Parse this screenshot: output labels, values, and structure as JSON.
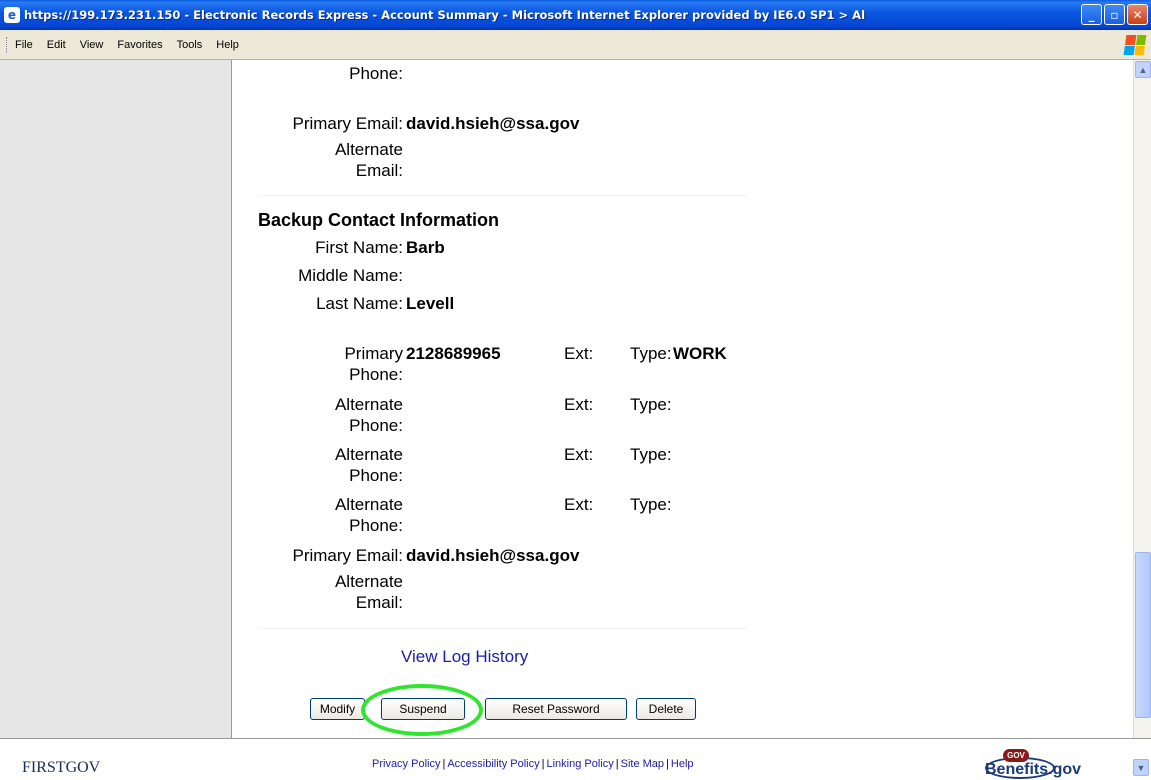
{
  "window": {
    "title": "https://199.173.231.150 - Electronic Records Express - Account Summary - Microsoft Internet Explorer provided by IE6.0 SP1 > Al",
    "ie_icon": "ie-icon",
    "min_glyph": "_",
    "max_glyph": "▫",
    "close_glyph": "✕"
  },
  "menu": {
    "items": [
      "File",
      "Edit",
      "View",
      "Favorites",
      "Tools",
      "Help"
    ]
  },
  "primary_contact": {
    "phone_label_tail": "Phone:",
    "primary_email_label": "Primary Email:",
    "primary_email": "david.hsieh@ssa.gov",
    "alternate_label": "Alternate",
    "email_label": "Email:"
  },
  "backup": {
    "heading": "Backup Contact Information",
    "first_name_label": "First Name:",
    "first_name": "Barb",
    "middle_name_label": "Middle Name:",
    "last_name_label": "Last Name:",
    "last_name": "Levell",
    "phones": [
      {
        "label_top": "Primary",
        "label_bottom": "Phone:",
        "number": "2128689965",
        "ext_label": "Ext:",
        "type_label": "Type:",
        "type": "WORK"
      },
      {
        "label_top": "Alternate",
        "label_bottom": "Phone:",
        "number": "",
        "ext_label": "Ext:",
        "type_label": "Type:",
        "type": ""
      },
      {
        "label_top": "Alternate",
        "label_bottom": "Phone:",
        "number": "",
        "ext_label": "Ext:",
        "type_label": "Type:",
        "type": ""
      },
      {
        "label_top": "Alternate",
        "label_bottom": "Phone:",
        "number": "",
        "ext_label": "Ext:",
        "type_label": "Type:",
        "type": ""
      }
    ],
    "primary_email_label": "Primary Email:",
    "primary_email": "david.hsieh@ssa.gov",
    "alternate_label": "Alternate",
    "email_label": "Email:"
  },
  "log_link": "View Log History",
  "buttons": {
    "modify": "Modify",
    "suspend": "Suspend",
    "reset_password": "Reset Password",
    "delete": "Delete"
  },
  "highlight_color": "#2ee62e",
  "footer": {
    "firstgov": "FIRSTGOV",
    "links": [
      "Privacy Policy",
      "Accessibility Policy",
      "Linking Policy",
      "Site Map",
      "Help"
    ],
    "separator": "|",
    "benefits_badge": "GOV",
    "benefits_text": "Benefits.gov"
  }
}
